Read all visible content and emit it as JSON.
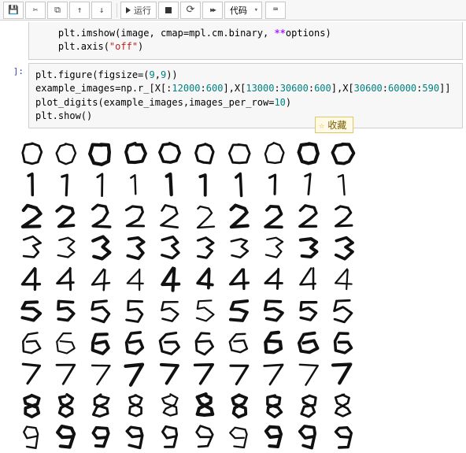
{
  "toolbar": {
    "run_label": "运行",
    "celltype": "代码",
    "kbd": "⌨"
  },
  "cell1": {
    "l1a": "    plt.imshow(image, cmap=mpl.cm.binary, ",
    "l1b": "**",
    "l1c": "options)",
    "l2a": "    plt.axis(",
    "l2b": "\"off\"",
    "l2c": ")"
  },
  "cell2": {
    "prompt": " ]:",
    "l1a": "plt.figure(figsize=(",
    "l1b": "9",
    "l1c": ",",
    "l1d": "9",
    "l1e": "))",
    "l2a": "example_images=np.r_[X[:",
    "l2b": "12000",
    "l2c": ":",
    "l2d": "600",
    "l2e": "],X[",
    "l2f": "13000",
    "l2g": ":",
    "l2h": "30600",
    "l2i": ":",
    "l2j": "600",
    "l2k": "],X[",
    "l2l": "30600",
    "l2m": ":",
    "l2n": "60000",
    "l2o": ":",
    "l2p": "590",
    "l2q": "]]",
    "l3a": "plot_digits(example_images,images_per_row=",
    "l3b": "10",
    "l3c": ")",
    "l4": "plt.show()"
  },
  "favorite": "收藏",
  "digits": {
    "rows": 10,
    "cols": 10,
    "values": [
      0,
      0,
      0,
      0,
      0,
      0,
      0,
      0,
      0,
      0,
      1,
      1,
      1,
      1,
      1,
      1,
      1,
      1,
      1,
      1,
      2,
      2,
      2,
      2,
      2,
      2,
      2,
      2,
      2,
      2,
      3,
      3,
      3,
      3,
      3,
      3,
      3,
      3,
      3,
      3,
      4,
      4,
      4,
      4,
      4,
      4,
      4,
      4,
      4,
      4,
      5,
      5,
      5,
      5,
      5,
      5,
      5,
      5,
      5,
      5,
      6,
      6,
      6,
      6,
      6,
      6,
      6,
      6,
      6,
      6,
      7,
      7,
      7,
      7,
      7,
      7,
      7,
      7,
      7,
      7,
      8,
      8,
      8,
      8,
      8,
      8,
      8,
      8,
      8,
      8,
      9,
      9,
      9,
      9,
      9,
      9,
      9,
      9,
      9,
      9
    ]
  }
}
